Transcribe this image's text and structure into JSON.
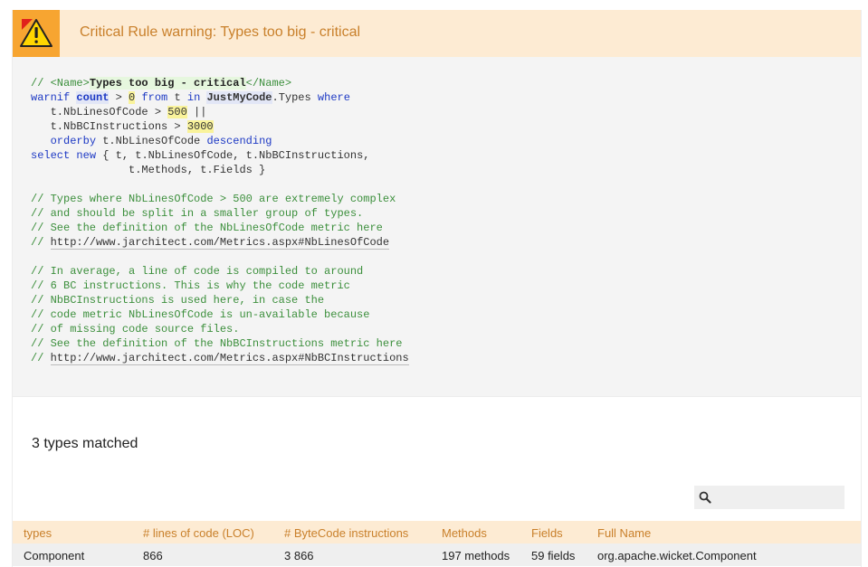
{
  "header": {
    "title": "Critical Rule warning: Types too big - critical",
    "icon": "warning-icon",
    "accent": "#f7a531"
  },
  "code": {
    "l1_comment_start": "// <Name>",
    "l1_name": "Types too big - critical",
    "l1_comment_end": "</Name>",
    "l2_warnif": "warnif",
    "l2_count": "count",
    "l2_gt": " > ",
    "l2_zero": "0",
    "l2_from": "from",
    "l2_t": " t ",
    "l2_in": "in",
    "l2_jmc": "JustMyCode",
    "l2_types": ".Types ",
    "l2_where": "where",
    "l3_expr": "   t.NbLinesOfCode > ",
    "l3_num": "500",
    "l3_or": " ||",
    "l4_expr": "   t.NbBCInstructions > ",
    "l4_num": "3000",
    "l5_orderby": "orderby",
    "l5_expr": " t.NbLinesOfCode ",
    "l5_desc": "descending",
    "l6_select": "select",
    "l6_new": "new",
    "l6_expr": " { t, t.NbLinesOfCode, t.NbBCInstructions,",
    "l7_expr": "               t.Methods, t.Fields }",
    "c1": "// Types where NbLinesOfCode > 500 are extremely complex",
    "c2": "// and should be split in a smaller group of types.",
    "c3": "// See the definition of the NbLinesOfCode metric here",
    "c4_prefix": "// ",
    "c4_url": "http://www.jarchitect.com/Metrics.aspx#NbLinesOfCode",
    "c5": "// In average, a line of code is compiled to around",
    "c6": "// 6 BC instructions. This is why the code metric",
    "c7": "// NbBCInstructions is used here, in case the",
    "c8": "// code metric NbLinesOfCode is un-available because",
    "c9": "// of missing code source files.",
    "c10": "// See the definition of the NbBCInstructions metric here",
    "c11_prefix": "// ",
    "c11_url": "http://www.jarchitect.com/Metrics.aspx#NbBCInstructions"
  },
  "results": {
    "matched": "3 types matched",
    "search_placeholder": "",
    "columns": [
      "types",
      "# lines of code (LOC)",
      "# ByteCode instructions",
      "Methods",
      "Fields",
      "Full Name"
    ],
    "rows": [
      [
        "Component",
        "866",
        "3 866",
        "197 methods",
        "59 fields",
        "org.apache.wicket.Component"
      ]
    ]
  }
}
